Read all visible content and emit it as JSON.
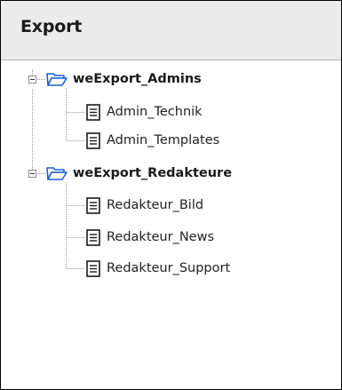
{
  "panel": {
    "title": "Export"
  },
  "tree": {
    "groups": [
      {
        "label": "weExport_Admins",
        "expanded": true,
        "icon": "open-folder-icon",
        "items": [
          {
            "label": "Admin_Technik",
            "icon": "document-icon"
          },
          {
            "label": "Admin_Templates",
            "icon": "document-icon"
          }
        ]
      },
      {
        "label": "weExport_Redakteure",
        "expanded": true,
        "icon": "open-folder-icon",
        "items": [
          {
            "label": "Redakteur_Bild",
            "icon": "document-icon"
          },
          {
            "label": "Redakteur_News",
            "icon": "document-icon"
          },
          {
            "label": "Redakteur_Support",
            "icon": "document-icon"
          }
        ]
      }
    ]
  },
  "colors": {
    "header_bg": "#ececec",
    "border": "#000000",
    "folder_blue": "#1c5fd6",
    "text": "#1a1a1a"
  }
}
